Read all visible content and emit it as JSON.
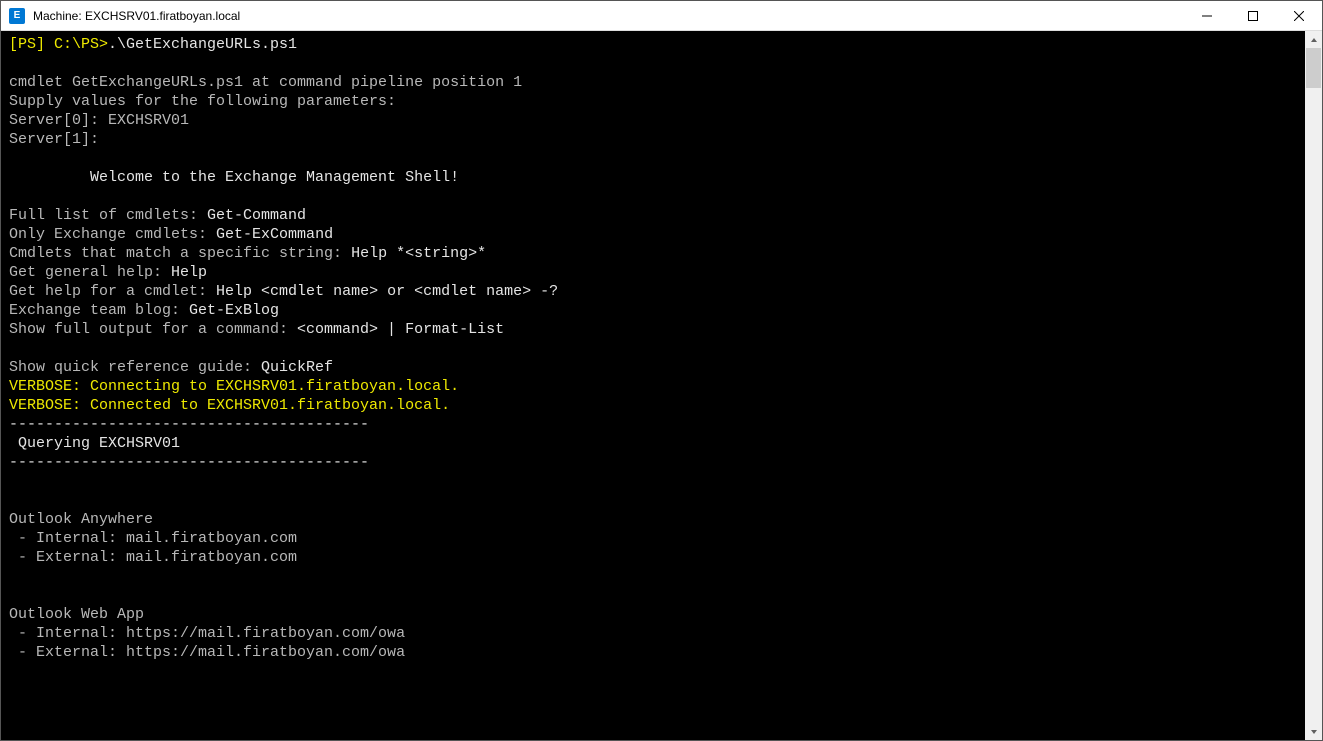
{
  "window": {
    "title": "Machine: EXCHSRV01.firatboyan.local",
    "icon_label": "E"
  },
  "terminal": {
    "prompt": "[PS] C:\\PS>",
    "command": ".\\GetExchangeURLs.ps1",
    "lines": {
      "l0": "",
      "cmdlet": "cmdlet GetExchangeURLs.ps1 at command pipeline position 1",
      "supply": "Supply values for the following parameters:",
      "server0": "Server[0]: EXCHSRV01",
      "server1": "Server[1]:",
      "blank1": "",
      "welcome": "         Welcome to the Exchange Management Shell!",
      "blank2": "",
      "full_pre": "Full list of cmdlets: ",
      "full_cmd": "Get-Command",
      "only_pre": "Only Exchange cmdlets: ",
      "only_cmd": "Get-ExCommand",
      "match_pre": "Cmdlets that match a specific string: ",
      "match_cmd": "Help *<string>*",
      "gen_pre": "Get general help: ",
      "gen_cmd": "Help",
      "help_pre": "Get help for a cmdlet: ",
      "help_cmd": "Help <cmdlet name> or <cmdlet name> -?",
      "blog_pre": "Exchange team blog: ",
      "blog_cmd": "Get-ExBlog",
      "show_pre": "Show full output for a command: ",
      "show_cmd": "<command> | Format-List",
      "blank3": "",
      "quick_pre": "Show quick reference guide: ",
      "quick_cmd": "QuickRef",
      "verbose1": "VERBOSE: Connecting to EXCHSRV01.firatboyan.local.",
      "verbose2": "VERBOSE: Connected to EXCHSRV01.firatboyan.local.",
      "dash1": "----------------------------------------",
      "query": " Querying EXCHSRV01",
      "dash2": "----------------------------------------",
      "blank4": "",
      "blank5": "",
      "oa_title": "Outlook Anywhere",
      "oa_int": " - Internal: mail.firatboyan.com",
      "oa_ext": " - External: mail.firatboyan.com",
      "blank6": "",
      "blank7": "",
      "owa_title": "Outlook Web App",
      "owa_int": " - Internal: https://mail.firatboyan.com/owa",
      "owa_ext": " - External: https://mail.firatboyan.com/owa"
    }
  }
}
